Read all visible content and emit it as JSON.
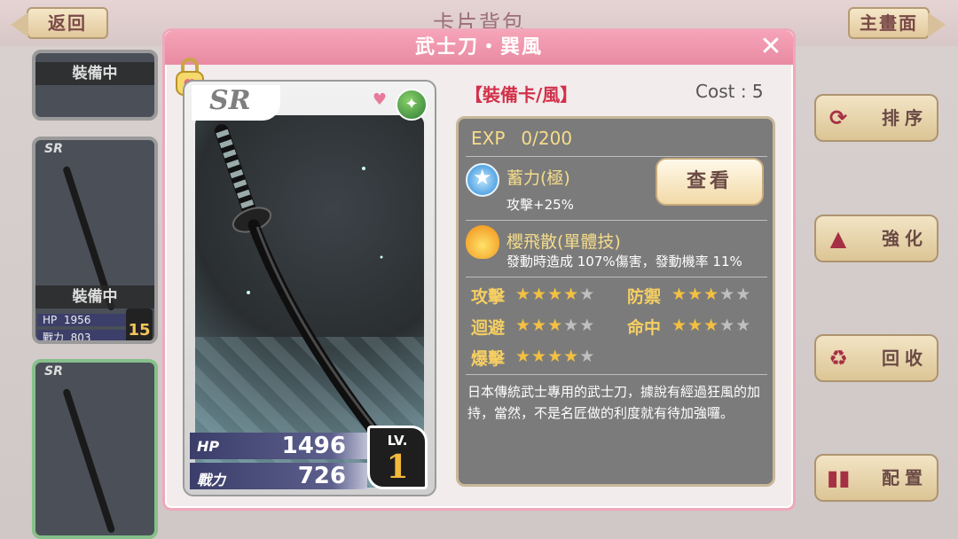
{
  "background": {
    "title": "卡片背包",
    "back_label": "返回",
    "main_label": "主畫面",
    "cards": [
      {
        "sr": "",
        "equipped": "裝備中",
        "hp_label": "",
        "hp": "",
        "power_label": "",
        "power": "",
        "level": ""
      },
      {
        "sr": "SR",
        "equipped": "裝備中",
        "hp_label": "HP",
        "hp": "1956",
        "power_label": "戰力",
        "power": "803",
        "level": "15"
      },
      {
        "sr": "SR",
        "equipped": "",
        "hp_label": "",
        "hp": "",
        "power_label": "",
        "power": "",
        "level": ""
      }
    ],
    "side_buttons": [
      {
        "label": "排序",
        "icon": "refresh-icon"
      },
      {
        "label": "強化",
        "icon": "enhance-icon"
      },
      {
        "label": "回收",
        "icon": "recycle-icon"
      },
      {
        "label": "配置",
        "icon": "cards-icon"
      }
    ]
  },
  "modal": {
    "title": "武士刀・巽風",
    "card": {
      "rarity": "SR",
      "hp_label": "HP",
      "hp": "1496",
      "power_label": "戰力",
      "power": "726",
      "lv_label": "LV.",
      "level": "1",
      "element_icon": "wind-element-icon"
    },
    "type": "【裝備卡/風】",
    "cost": "Cost : 5",
    "exp_label": "EXP",
    "exp_value": "0/200",
    "view_button": "查看",
    "skills": [
      {
        "name": "蓄力(極)",
        "desc": "攻擊+25%",
        "icon": "star-skill-icon"
      },
      {
        "name": "櫻飛散(單體技)",
        "desc": "發動時造成 107%傷害，發動機率 11%",
        "icon": "fire-skill-icon"
      }
    ],
    "attributes": [
      {
        "label": "攻擊",
        "stars": 4
      },
      {
        "label": "防禦",
        "stars": 3
      },
      {
        "label": "迴避",
        "stars": 3
      },
      {
        "label": "命中",
        "stars": 3
      },
      {
        "label": "爆擊",
        "stars": 4
      }
    ],
    "description": "日本傳統武士專用的武士刀，據說有經過狂風的加持，當然，不是名匠做的利度就有待加強囉。",
    "colors": {
      "accent": "#f6a3b7",
      "gold": "#f6dc8a",
      "danger": "#d2304a"
    }
  }
}
